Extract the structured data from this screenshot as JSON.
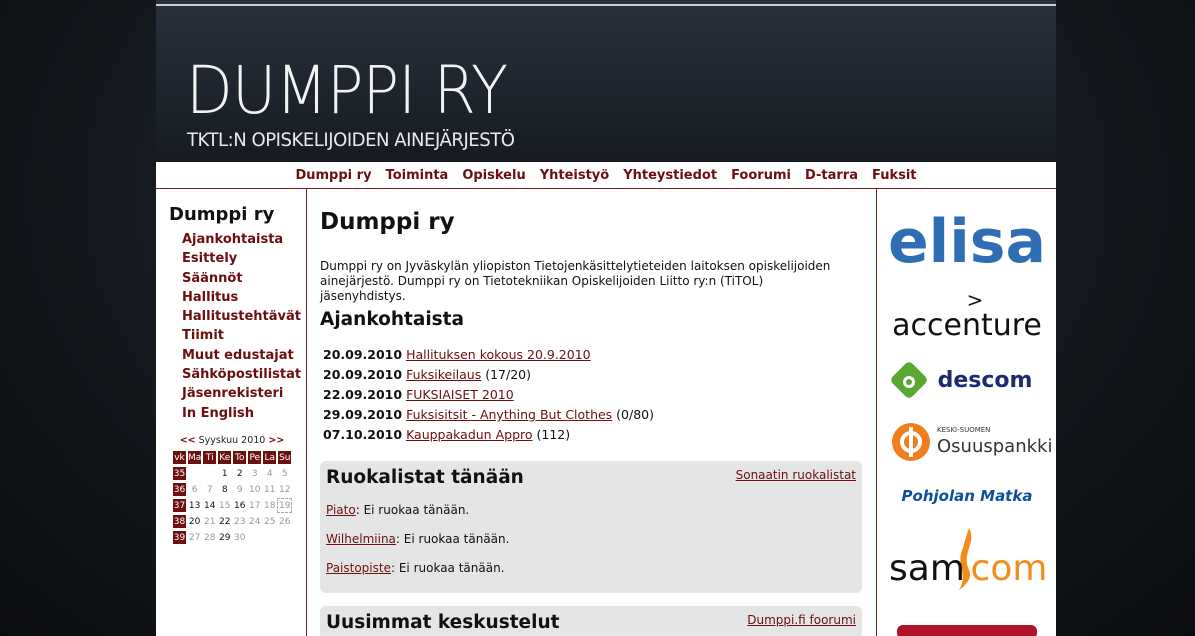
{
  "header": {
    "title": "DUMPPI RY",
    "subtitle": "TKTL:N OPISKELIJOIDEN AINEJÄRJESTÖ"
  },
  "nav": {
    "items": [
      "Dumppi ry",
      "Toiminta",
      "Opiskelu",
      "Yhteistyö",
      "Yhteystiedot",
      "Foorumi",
      "D-tarra",
      "Fuksit"
    ]
  },
  "sidebar": {
    "heading": "Dumppi ry",
    "items": [
      "Ajankohtaista",
      "Esittely",
      "Säännöt",
      "Hallitus",
      "Hallitustehtävät",
      "Tiimit",
      "Muut edustajat",
      "Sähköpostilistat",
      "Jäsenrekisteri",
      "In English"
    ]
  },
  "calendar": {
    "prev": "<<",
    "month": "Syyskuu 2010",
    "next": ">>",
    "headers": [
      "vk",
      "Ma",
      "Ti",
      "Ke",
      "To",
      "Pe",
      "La",
      "Su"
    ],
    "weeks": [
      {
        "wk": "35",
        "days": [
          "",
          "",
          "1",
          "2",
          "3",
          "4",
          "5"
        ]
      },
      {
        "wk": "36",
        "days": [
          "6",
          "7",
          "8",
          "9",
          "10",
          "11",
          "12"
        ]
      },
      {
        "wk": "37",
        "days": [
          "13",
          "14",
          "15",
          "16",
          "17",
          "18",
          "19"
        ]
      },
      {
        "wk": "38",
        "days": [
          "20",
          "21",
          "22",
          "23",
          "24",
          "25",
          "26"
        ]
      },
      {
        "wk": "39",
        "days": [
          "27",
          "28",
          "29",
          "30",
          "",
          "",
          ""
        ]
      }
    ]
  },
  "main": {
    "title": "Dumppi ry",
    "intro": "Dumppi ry on Jyväskylän yliopiston Tietojenkäsittelytieteiden laitoksen opiskelijoiden ainejärjestö. Dumppi ry on Tietotekniikan Opiskelijoiden Liitto ry:n (TiTOL) jäsenyhdistys.",
    "news_title": "Ajankohtaista",
    "news": [
      {
        "date": "20.09.2010",
        "link": "Hallituksen kokous 20.9.2010",
        "extra": ""
      },
      {
        "date": "20.09.2010",
        "link": "Fuksikeilaus",
        "extra": " (17/20)"
      },
      {
        "date": "22.09.2010",
        "link": "FUKSIAISET 2010",
        "extra": ""
      },
      {
        "date": "29.09.2010",
        "link": "Fuksisitsit - Anything But Clothes",
        "extra": " (0/80)"
      },
      {
        "date": "07.10.2010",
        "link": "Kauppakadun Appro",
        "extra": " (112)"
      }
    ],
    "food": {
      "title": "Ruokalistat tänään",
      "link": "Sonaatin ruokalistat",
      "items": [
        {
          "place": "Piato",
          "text": ": Ei ruokaa tänään."
        },
        {
          "place": "Wilhelmiina",
          "text": ": Ei ruokaa tänään."
        },
        {
          "place": "Paistopiste",
          "text": ": Ei ruokaa tänään."
        }
      ]
    },
    "forum": {
      "title": "Uusimmat keskustelut",
      "link": "Dumppi.fi foorumi"
    }
  },
  "sponsors": [
    "elisa",
    "accenture",
    "descom",
    "Osuuspankki",
    "Pohjolan Matka",
    "samcom"
  ],
  "sponsor_extra": {
    "accenture_mark": ">",
    "op_small": "KESKI-SUOMEN",
    "samcom_left": "sam",
    "samcom_right": "com"
  },
  "colors": {
    "accent": "#6b0f0f",
    "elisa": "#2f6db5",
    "descom_green": "#5aa832",
    "descom_text": "#1d2a6b",
    "op_orange": "#f07d1e",
    "pohjola_blue": "#0f4f9a",
    "samcom_orange": "#f28c1a"
  }
}
